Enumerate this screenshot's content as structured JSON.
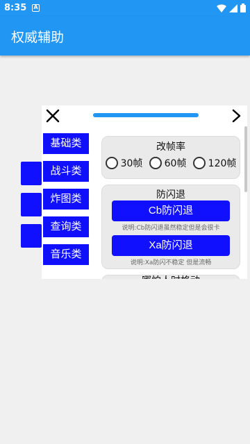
{
  "status": {
    "time": "8:35",
    "a_icon": "A"
  },
  "app": {
    "title": "权威辅助"
  },
  "overlay": {
    "categories": [
      {
        "label": "基础类"
      },
      {
        "label": "战斗类"
      },
      {
        "label": "炸图类"
      },
      {
        "label": "查询类"
      },
      {
        "label": "音乐类"
      }
    ],
    "fps_section": {
      "title": "改帧率",
      "options": [
        {
          "label": "30帧"
        },
        {
          "label": "60帧"
        },
        {
          "label": "120帧"
        }
      ]
    },
    "anti_crash": {
      "title": "防闪退",
      "cb_button": "Cb防闪退",
      "cb_desc": "说明:Cb防闪退虽然稳定但是会很卡",
      "xa_button": "Xa防闪退",
      "xa_desc": "说明:Xa防闪不稳定 但是流畅"
    },
    "next_section_title": "哪怕人时格动"
  },
  "colors": {
    "primary": "#2196f3",
    "button_blue": "#1010ff"
  }
}
